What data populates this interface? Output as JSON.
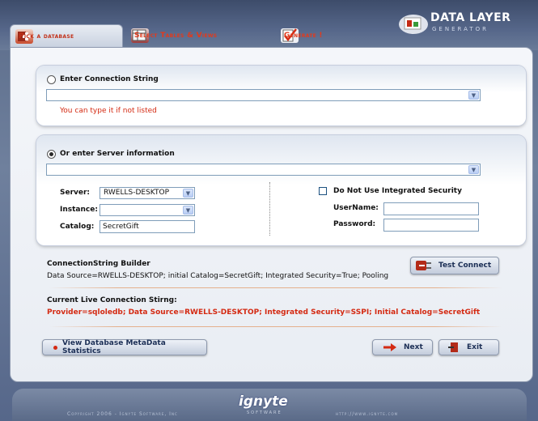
{
  "tabs": [
    {
      "label": "Pick a database",
      "active": true,
      "icon": "database-plus-icon"
    },
    {
      "label": "Select Tables & Views",
      "active": false,
      "icon": "tables-icon"
    },
    {
      "label": "Generate !",
      "active": false,
      "icon": "checkmark-doc-icon"
    }
  ],
  "logo": {
    "main": "DATA LAYER",
    "sub": "GENERATOR"
  },
  "connection_string": {
    "radio_label": "Enter Connection String",
    "selected": false,
    "value": "",
    "hint": "You can type it if not listed"
  },
  "server_info": {
    "radio_label": "Or enter Server information",
    "selected": true,
    "combo_value": "",
    "server_label": "Server:",
    "server_value": "RWELLS-DESKTOP",
    "instance_label": "Instance:",
    "instance_value": "",
    "catalog_label": "Catalog:",
    "catalog_value": "SecretGift",
    "integrated_security_label": "Do Not Use Integrated Security",
    "integrated_security_checked": false,
    "username_label": "UserName:",
    "username_value": "",
    "password_label": "Password:",
    "password_value": ""
  },
  "builder": {
    "title": "ConnectionString Builder",
    "text": "Data Source=RWELLS-DESKTOP; initial Catalog=SecretGift; Integrated Security=True; Pooling",
    "test_button": "Test Connect"
  },
  "live": {
    "title": "Current Live Connection Stirng:",
    "text": "Provider=sqloledb; Data Source=RWELLS-DESKTOP; Integrated Security=SSPI; Initial Catalog=SecretGift"
  },
  "buttons": {
    "metadata": "View Database MetaData Statistics",
    "next": "Next",
    "exit": "Exit"
  },
  "footer": {
    "copyright": "Copyright 2006 - Ignyte Software, Inc",
    "brand": "ignyte",
    "brand_sub": "SOFTWARE",
    "url": "http://www.ignyte.com"
  },
  "colors": {
    "accent_red": "#d42a12",
    "navy": "#1c2f56",
    "frame": "#5b6c8a"
  }
}
